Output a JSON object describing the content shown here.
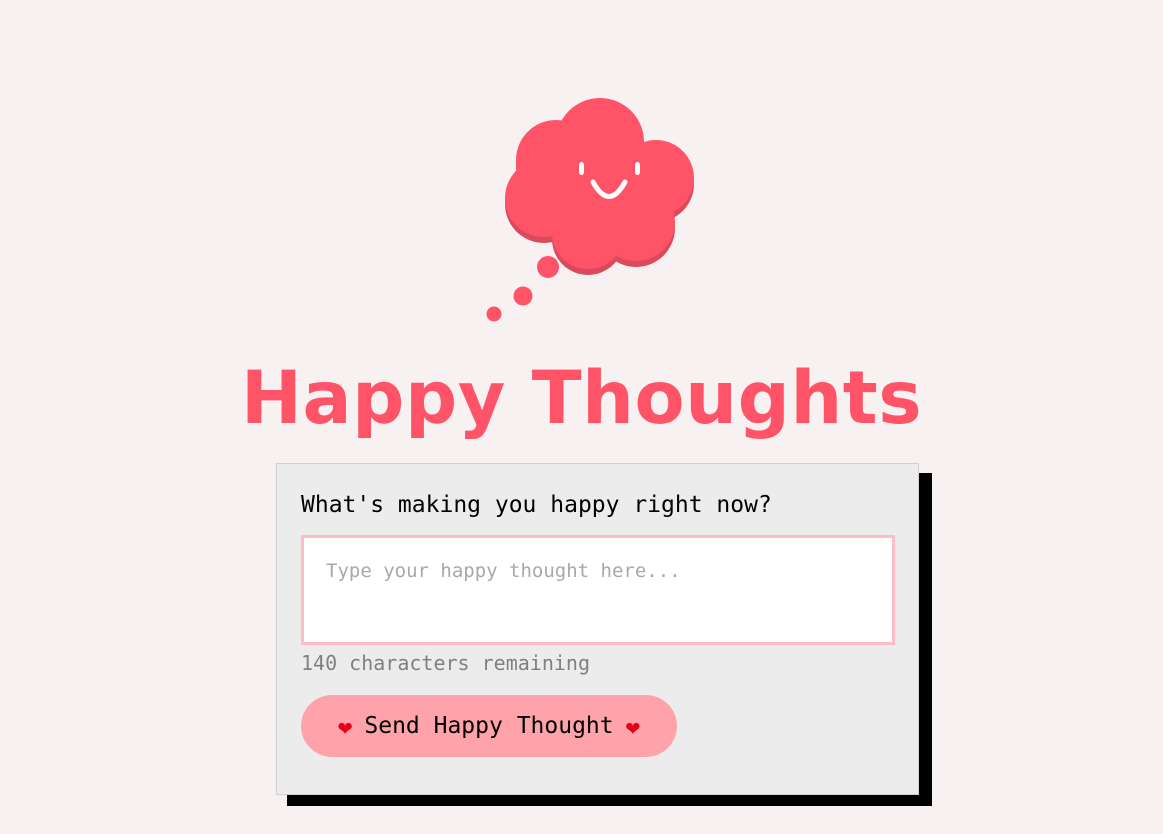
{
  "header": {
    "logo_icon": "smiling-thought-cloud-icon",
    "title": "Happy Thoughts"
  },
  "form": {
    "question": "What's making you happy right now?",
    "input_value": "",
    "input_placeholder": "Type your happy thought here...",
    "char_counter": "140 characters remaining",
    "send_button": {
      "label": "Send Happy Thought",
      "icon": "heart-icon"
    }
  },
  "colors": {
    "brand": "#ff5468",
    "background": "#f8f1f1",
    "card": "#ececec",
    "input_border": "#ffbcc4",
    "button": "#ffa3ab",
    "heart": "#e8001a"
  }
}
